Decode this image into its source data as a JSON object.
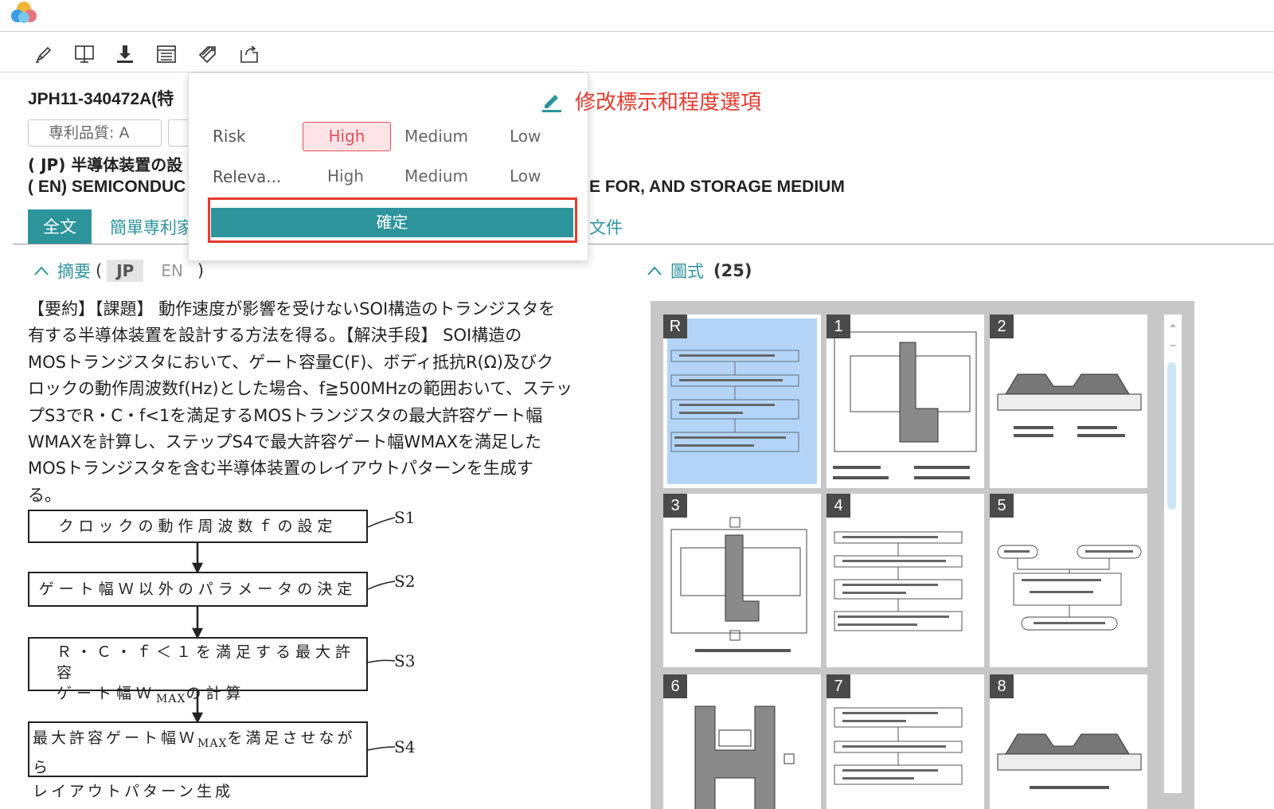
{
  "app": {
    "logo_icon": "cloud-logo"
  },
  "toolbar": {
    "items": [
      {
        "icon": "highlighter-icon"
      },
      {
        "icon": "reader-view-icon"
      },
      {
        "icon": "download-icon"
      },
      {
        "icon": "list-view-icon"
      },
      {
        "icon": "tag-icon"
      },
      {
        "icon": "export-icon"
      }
    ]
  },
  "doc": {
    "id": "JPH11-340472A(特",
    "quality_label": "専利品質: A",
    "title_jp": "( JP) 半導体装置の設",
    "title_en": "( EN) SEMICONDUC",
    "title_en_tail": "E FOR, AND STORAGE MEDIUM"
  },
  "tabs": {
    "active": "全文",
    "second": "簡單専利家",
    "last": "文件"
  },
  "popup": {
    "risk_label": "Risk",
    "relevance_label": "Releva...",
    "risk_options": [
      "High",
      "Medium",
      "Low"
    ],
    "relevance_options": [
      "High",
      "Medium",
      "Low"
    ],
    "risk_selected": "High",
    "confirm_label": "確定",
    "edit_icon": "pencil-icon"
  },
  "annotation": {
    "text": "修改標示和程度選項"
  },
  "abstract": {
    "header": "摘要",
    "lang_jp": "JP",
    "lang_en": "EN",
    "open_paren": "(",
    "close_paren": ")",
    "lines": [
      "【要約】【課題】 動作速度が影響を受けないSOI構造のトランジスタを",
      "有する半導体装置を設計する方法を得る。【解決手段】 SOI構造の",
      "MOSトランジスタにおいて、ゲート容量C(F)、ボディ抵抗R(Ω)及びク",
      "ロックの動作周波数f(Hz)とした場合、f≧500MHzの範囲おいて、ステッ",
      "プS3でR・C・f<1を満足するMOSトランジスタの最大許容ゲート幅",
      "WMAXを計算し、ステップS4で最大許容ゲート幅WMAXを満足した",
      "MOSトランジスタを含む半導体装置のレイアウトパターンを生成す",
      "る。"
    ],
    "flow": {
      "s1_text": "クロックの動作周波数ｆの設定",
      "s1_label": "S1",
      "s2_text": "ゲート幅Ｗ以外のパラメータの決定",
      "s2_label": "S2",
      "s3_line1": "Ｒ・Ｃ・ｆ＜１を満足する最大許容",
      "s3_line2a": "ゲート幅Ｗ",
      "s3_sub": "MAX",
      "s3_line2b": "の計算",
      "s3_label": "S3",
      "s4_line1a": "最大許容ゲート幅Ｗ",
      "s4_sub": "MAX",
      "s4_line1b": "を満足させながら",
      "s4_line2": "レイアウトパターン生成",
      "s4_label": "S4"
    }
  },
  "figures": {
    "header": "圖式",
    "count": "(25)",
    "thumbs": [
      {
        "label": "R",
        "selected": true
      },
      {
        "label": "1"
      },
      {
        "label": "2"
      },
      {
        "label": "3"
      },
      {
        "label": "4"
      },
      {
        "label": "5"
      },
      {
        "label": "6"
      },
      {
        "label": "7"
      },
      {
        "label": "8"
      }
    ]
  }
}
